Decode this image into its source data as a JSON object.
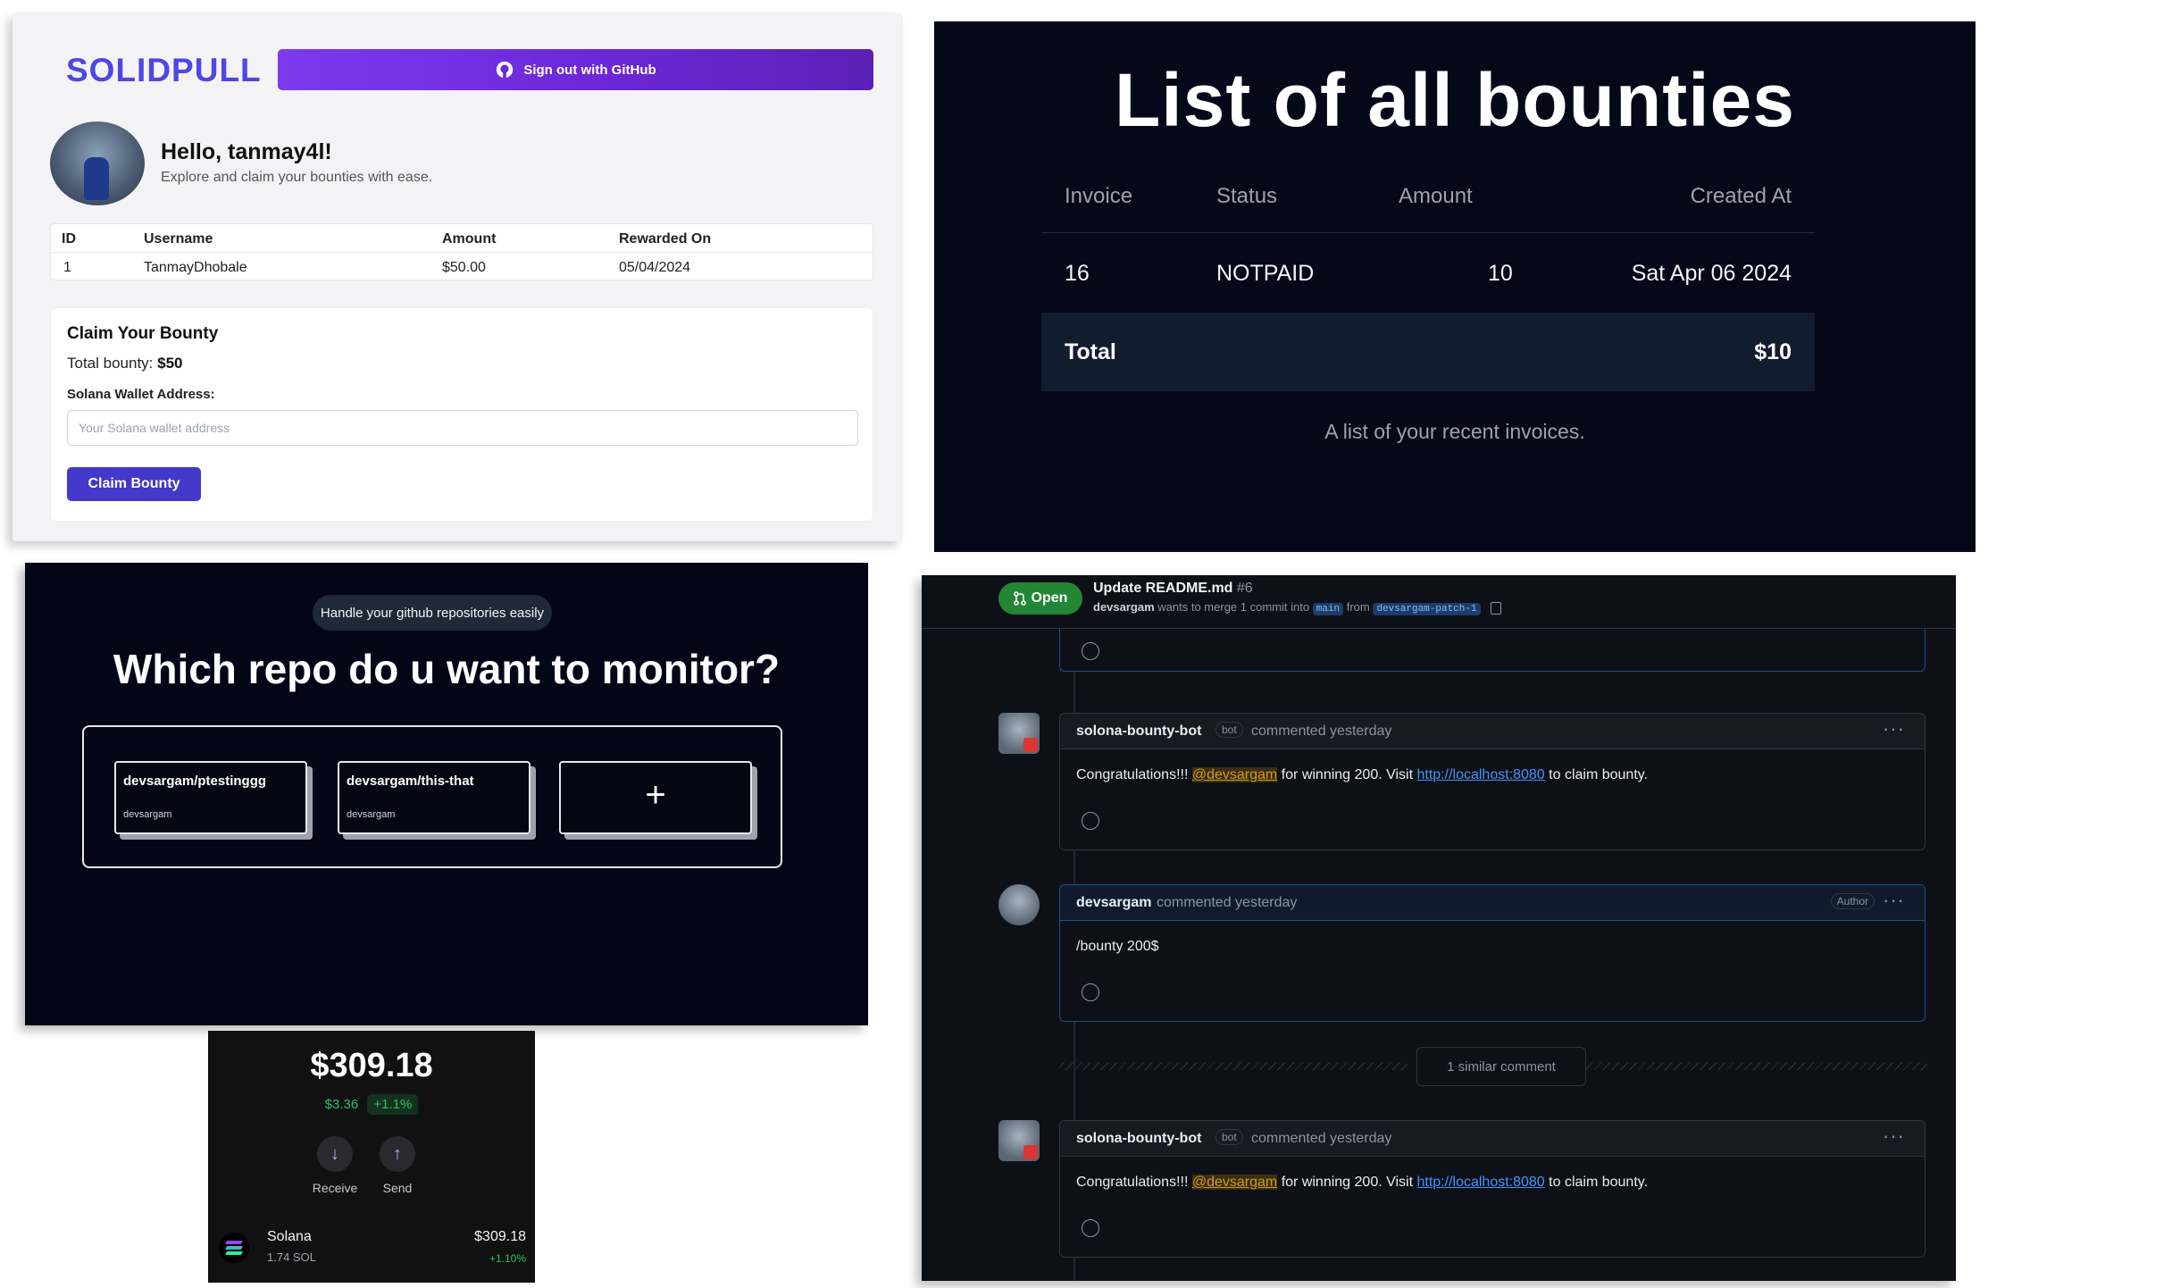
{
  "solidpull": {
    "logo": "SOLIDPULL",
    "signout_label": "Sign out with GitHub",
    "greeting": "Hello, tanmay4l!",
    "subtitle": "Explore and claim your bounties with ease.",
    "table": {
      "headers": [
        "ID",
        "Username",
        "Amount",
        "Rewarded On"
      ],
      "rows": [
        [
          "1",
          "TanmayDhobale",
          "$50.00",
          "05/04/2024"
        ]
      ]
    },
    "claim": {
      "title": "Claim Your Bounty",
      "total_label": "Total bounty:",
      "total_value": "$50",
      "wallet_label": "Solana Wallet Address:",
      "wallet_placeholder": "Your Solana wallet address",
      "button_label": "Claim Bounty"
    }
  },
  "bounties": {
    "title": "List of all bounties",
    "headers": [
      "Invoice",
      "Status",
      "Amount",
      "Created At"
    ],
    "rows": [
      [
        "16",
        "NOTPAID",
        "10",
        "Sat Apr 06 2024"
      ]
    ],
    "total_label": "Total",
    "total_value": "$10",
    "caption": "A list of your recent invoices."
  },
  "repo_monitor": {
    "pill": "Handle your github repositories easily",
    "question": "Which repo do u want to monitor?",
    "repos": [
      {
        "name": "devsargam/ptestinggg",
        "owner": "devsargam"
      },
      {
        "name": "devsargam/this-that",
        "owner": "devsargam"
      }
    ],
    "add_symbol": "+"
  },
  "wallet": {
    "balance": "$309.18",
    "change": "$3.36",
    "change_pct": "+1.1%",
    "actions": [
      {
        "label": "Receive",
        "icon": "arrow-down-icon"
      },
      {
        "label": "Send",
        "icon": "arrow-up-icon"
      }
    ],
    "token": {
      "name": "Solana",
      "amount": "1.74 SOL",
      "value": "$309.18",
      "pct": "+1.10%"
    }
  },
  "pr": {
    "state": "Open",
    "title": "Update README.md",
    "number": "#6",
    "merge": {
      "author": "devsargam",
      "text": "wants to merge 1 commit into",
      "base": "main",
      "from": "from",
      "head": "devsargam-patch-1"
    },
    "comments": [
      {
        "author": "solona-bounty-bot",
        "badge": "bot",
        "meta": "commented yesterday",
        "pre": "Congratulations!!! ",
        "mention": "@devsargam",
        "mid": " for winning 200. Visit ",
        "link": "http://localhost:8080",
        "post": " to claim bounty."
      },
      {
        "author": "devsargam",
        "badge": "Author",
        "meta": "commented yesterday",
        "body": "/bounty 200$"
      },
      {
        "author": "solona-bounty-bot",
        "badge": "bot",
        "meta": "commented yesterday",
        "pre": "Congratulations!!! ",
        "mention": "@devsargam",
        "mid": " for winning 200. Visit ",
        "link": "http://localhost:8080",
        "post": " to claim bounty."
      }
    ],
    "similar": "1 similar comment",
    "more_label": "···"
  },
  "colors": {
    "brand": "#4f46e5",
    "github_dark": "#0d1117",
    "open_green": "#238636",
    "link_blue": "#4493f8"
  }
}
